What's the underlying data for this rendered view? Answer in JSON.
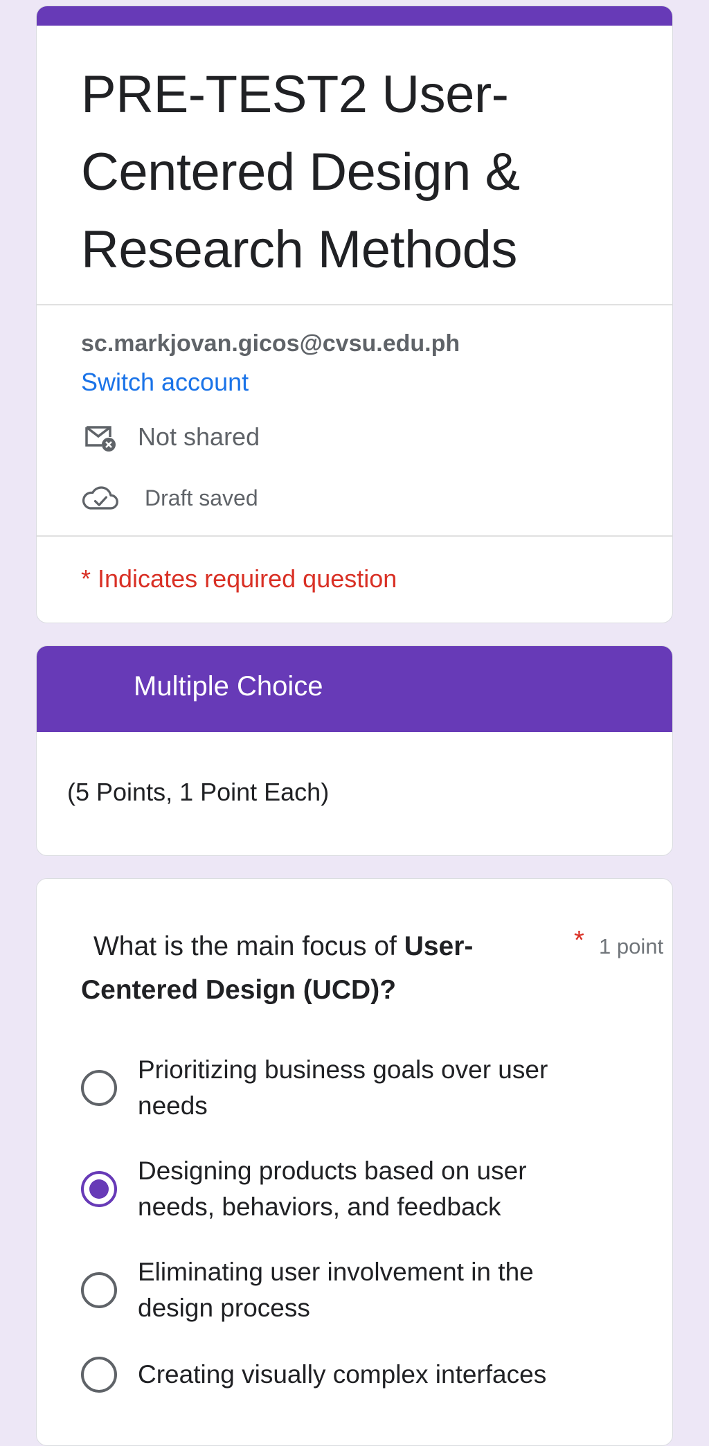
{
  "form": {
    "title": "PRE-TEST2 User-Centered Design & Research Methods",
    "account_email": "sc.markjovan.gicos@cvsu.edu.ph",
    "switch_account_label": "Switch account",
    "not_shared_label": "Not shared",
    "draft_saved_label": "Draft saved",
    "required_notice": "* Indicates required question"
  },
  "section": {
    "title": "Multiple Choice",
    "description": "(5 Points, 1 Point Each)"
  },
  "question": {
    "text_prefix": "What is the main focus of ",
    "text_bold": "User-Centered Design (UCD)?",
    "required_marker": "*",
    "points_label": "1 point",
    "selected_index": 1,
    "options": [
      "Prioritizing business goals over user needs",
      "Designing products based on user needs, behaviors, and feedback",
      "Eliminating user involvement in the design process",
      "Creating visually complex interfaces"
    ]
  },
  "icons": [
    "mail-x-icon",
    "cloud-check-icon"
  ],
  "colors": {
    "accent": "#673ab7",
    "background": "#ede7f6",
    "link": "#1a73e8",
    "required": "#d93025"
  }
}
